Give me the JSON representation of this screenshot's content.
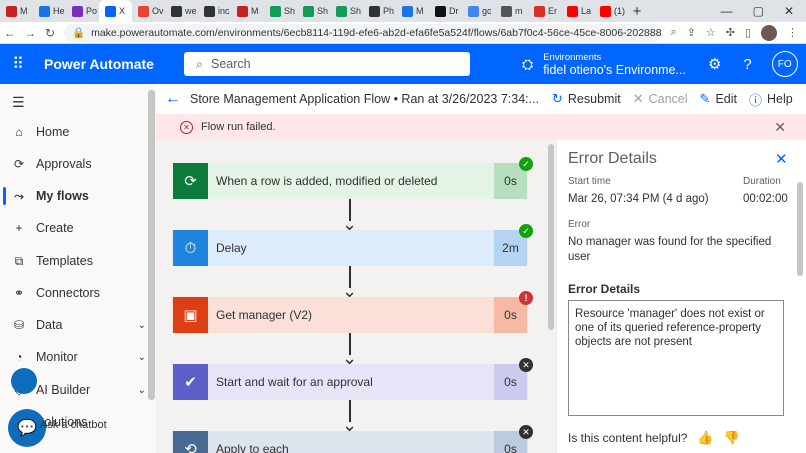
{
  "browser": {
    "tabs": [
      {
        "label": "M",
        "color": "#c5221f"
      },
      {
        "label": "He",
        "color": "#1a73e8"
      },
      {
        "label": "Po",
        "color": "#7b2cbf"
      },
      {
        "label": "X",
        "color": "#0066ff"
      },
      {
        "label": "Ov",
        "color": "#ea4335"
      },
      {
        "label": "we",
        "color": "#333333"
      },
      {
        "label": "inc",
        "color": "#333333"
      },
      {
        "label": "M",
        "color": "#c5221f"
      },
      {
        "label": "Sh",
        "color": "#0f9d58"
      },
      {
        "label": "Sh",
        "color": "#0f9d58"
      },
      {
        "label": "Sh",
        "color": "#0f9d58"
      },
      {
        "label": "Ph",
        "color": "#333333"
      },
      {
        "label": "M",
        "color": "#1a73e8"
      },
      {
        "label": "Dr",
        "color": "#111111"
      },
      {
        "label": "gc",
        "color": "#4285f4"
      },
      {
        "label": "m",
        "color": "#555555"
      },
      {
        "label": "Er",
        "color": "#d93025"
      },
      {
        "label": "La",
        "color": "#ff0000"
      },
      {
        "label": "(1)",
        "color": "#ff0000"
      }
    ],
    "new_tab": "+",
    "url": "make.powerautomate.com/environments/6ecb8114-119d-efe6-ab2d-efa6fe5a524f/flows/6ab7f0c4-56ce-45ce-8006-202888d05e12/runs/08585..."
  },
  "header": {
    "brand": "Power Automate",
    "search_placeholder": "Search",
    "env_label": "Environments",
    "env_name": "fidel otieno's Environme...",
    "avatar": "FO"
  },
  "nav": {
    "items": [
      {
        "label": "Home",
        "icon": "home-icon",
        "glyph": "⌂"
      },
      {
        "label": "Approvals",
        "icon": "approvals-icon",
        "glyph": "⟳"
      },
      {
        "label": "My flows",
        "icon": "flows-icon",
        "glyph": "⤳"
      },
      {
        "label": "Create",
        "icon": "plus-icon",
        "glyph": "+"
      },
      {
        "label": "Templates",
        "icon": "templates-icon",
        "glyph": "⧉"
      },
      {
        "label": "Connectors",
        "icon": "connectors-icon",
        "glyph": "⚭"
      },
      {
        "label": "Data",
        "icon": "data-icon",
        "glyph": "⛁"
      },
      {
        "label": "Monitor",
        "icon": "monitor-icon",
        "glyph": "◔"
      },
      {
        "label": "AI Builder",
        "icon": "ai-icon",
        "glyph": "◇"
      },
      {
        "label": "Solutions",
        "icon": "solutions-icon",
        "glyph": "▦"
      }
    ],
    "chatbot_label": "Ask a chatbot"
  },
  "command_bar": {
    "title": "Store Management Application Flow • Ran at 3/26/2023 7:34:...",
    "resubmit": "Resubmit",
    "cancel": "Cancel",
    "edit": "Edit",
    "help": "Help"
  },
  "banner": {
    "message": "Flow run failed."
  },
  "steps": [
    {
      "label": "When a row is added, modified or deleted",
      "duration": "0s",
      "status": "success",
      "color": "#0b7a3a",
      "light": "#e3f3e6",
      "dur_bg": "#b7dfbe"
    },
    {
      "label": "Delay",
      "duration": "2m",
      "status": "success",
      "color": "#1f85de",
      "light": "#dcecfb",
      "dur_bg": "#b4d4f3"
    },
    {
      "label": "Get manager (V2)",
      "duration": "0s",
      "status": "failed",
      "color": "#dc3e15",
      "light": "#fbe0d8",
      "dur_bg": "#f6b9a6"
    },
    {
      "label": "Start and wait for an approval",
      "duration": "0s",
      "status": "skipped",
      "color": "#5b5fc7",
      "light": "#e6e4f7",
      "dur_bg": "#cdcaf0"
    },
    {
      "label": "Apply to each",
      "duration": "0s",
      "status": "skipped",
      "color": "#486991",
      "light": "#dde4ee",
      "dur_bg": "#bccbe0"
    }
  ],
  "details": {
    "title": "Error Details",
    "start_time_label": "Start time",
    "start_time": "Mar 26, 07:34 PM (4 d ago)",
    "duration_label": "Duration",
    "duration": "00:02:00",
    "error_label": "Error",
    "error": "No manager was found for the specified user",
    "error_details_heading": "Error Details",
    "error_details": "Resource 'manager' does not exist or one of its queried reference-property objects are not present",
    "feedback": "Is this content helpful?"
  }
}
